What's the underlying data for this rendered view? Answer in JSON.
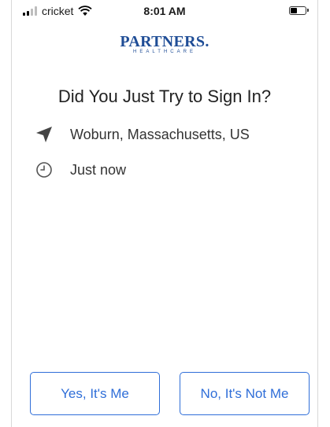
{
  "status_bar": {
    "carrier": "cricket",
    "time": "8:01 AM"
  },
  "logo": {
    "name": "PARTNERS.",
    "subtitle": "HEALTHCARE"
  },
  "prompt": {
    "title": "Did You Just Try to Sign In?",
    "location": "Woburn, Massachusetts, US",
    "time": "Just now"
  },
  "actions": {
    "yes_label": "Yes, It's Me",
    "no_label": "No, It's Not Me"
  },
  "colors": {
    "accent": "#2f6ed8",
    "logo": "#1f4d96"
  }
}
